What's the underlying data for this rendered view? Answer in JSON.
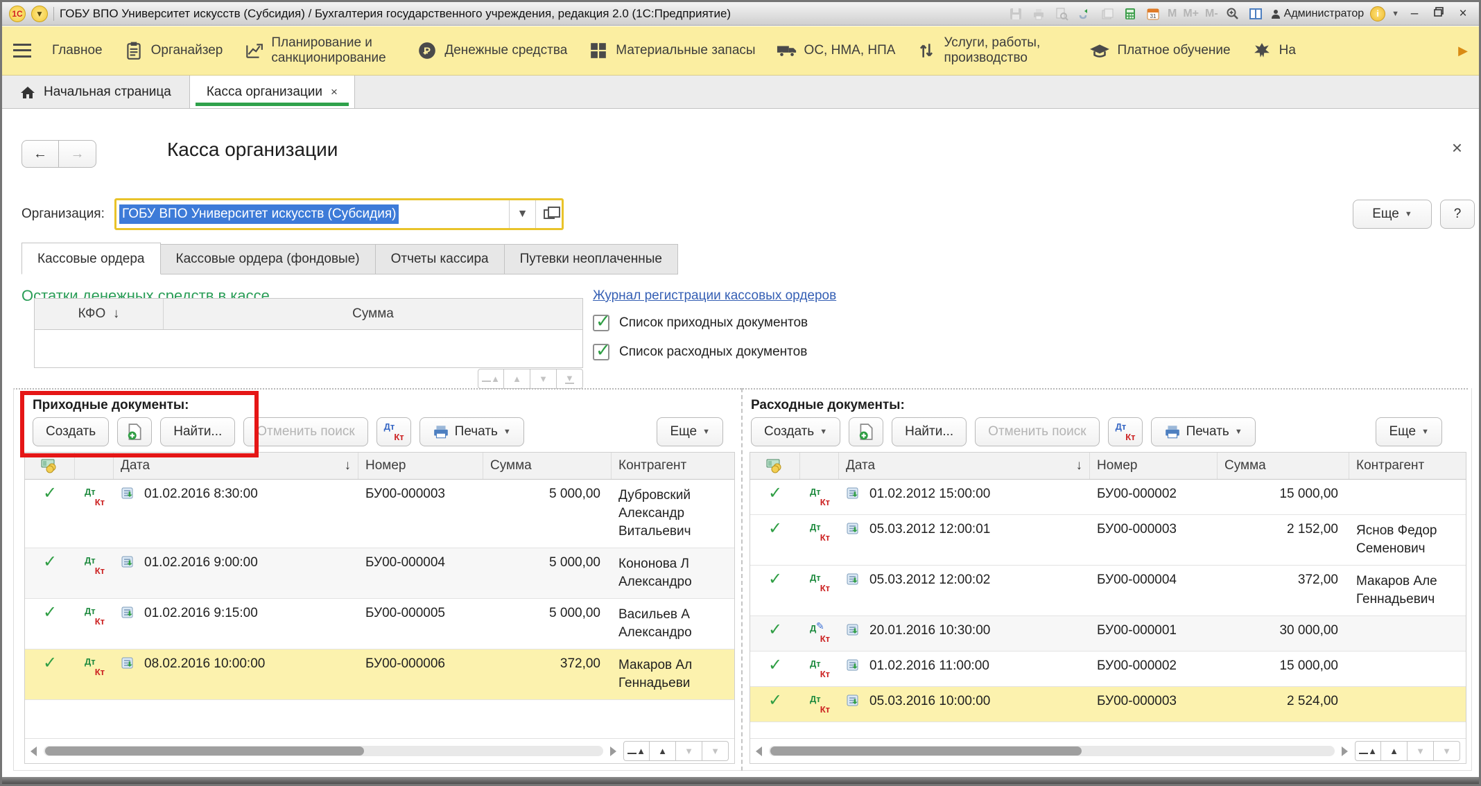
{
  "titlebar": {
    "title": "ГОБУ ВПО Университет искусств (Субсидия) / Бухгалтерия государственного учреждения, редакция 2.0  (1С:Предприятие)",
    "memory_buttons": [
      "M",
      "M+",
      "M-"
    ],
    "user": "Администратор"
  },
  "ribbon": {
    "items": [
      {
        "icon": "none",
        "label": "Главное",
        "wrap": false
      },
      {
        "icon": "clipboard",
        "label": "Органайзер",
        "wrap": false
      },
      {
        "icon": "planning",
        "label": "Планирование и санкционирование",
        "wrap": true
      },
      {
        "icon": "ruble",
        "label": "Денежные средства",
        "wrap": false
      },
      {
        "icon": "grid",
        "label": "Материальные запасы",
        "wrap": false
      },
      {
        "icon": "truck",
        "label": "ОС, НМА, НПА",
        "wrap": false
      },
      {
        "icon": "updown",
        "label": "Услуги, работы, производство",
        "wrap": true
      },
      {
        "icon": "gradcap",
        "label": "Платное обучение",
        "wrap": false
      },
      {
        "icon": "emblem",
        "label": "На",
        "wrap": false
      }
    ]
  },
  "tabbar": {
    "home": "Начальная страница",
    "active_tab": "Касса организации",
    "close_glyph": "×"
  },
  "form": {
    "title": "Касса организации",
    "org_label": "Организация:",
    "org_value": "ГОБУ ВПО Университет искусств (Субсидия)",
    "more_label": "Еще",
    "help_label": "?"
  },
  "subtabs": [
    {
      "label": "Кассовые ордера",
      "active": true
    },
    {
      "label": "Кассовые ордера (фондовые)",
      "active": false
    },
    {
      "label": "Отчеты кассира",
      "active": false
    },
    {
      "label": "Путевки неоплаченные",
      "active": false
    }
  ],
  "balances": {
    "heading": "Остатки денежных средств в кассе",
    "columns": [
      "КФО",
      "Сумма"
    ],
    "rows": []
  },
  "journal_link": "Журнал регистрации кассовых ордеров",
  "checkboxes": [
    {
      "label": "Список приходных документов",
      "checked": true
    },
    {
      "label": "Список расходных документов",
      "checked": true
    }
  ],
  "income_panel": {
    "label": "Приходные документы:",
    "buttons": {
      "create": "Создать",
      "create_has_dropdown": false,
      "find": "Найти...",
      "cancel_search": "Отменить поиск",
      "print": "Печать",
      "more": "Еще"
    },
    "columns": {
      "date": "Дата",
      "number": "Номер",
      "amount": "Сумма",
      "contragent": "Контрагент"
    },
    "rows": [
      {
        "date": "01.02.2016 8:30:00",
        "number": "БУ00-000003",
        "amount": "5 000,00",
        "contragent": [
          "Дубровский",
          "Александр",
          "Витальевич"
        ],
        "selected": false,
        "shaded": false,
        "edited": false
      },
      {
        "date": "01.02.2016 9:00:00",
        "number": "БУ00-000004",
        "amount": "5 000,00",
        "contragent": [
          "Кононова Л",
          "Александро"
        ],
        "selected": false,
        "shaded": true,
        "edited": false
      },
      {
        "date": "01.02.2016 9:15:00",
        "number": "БУ00-000005",
        "amount": "5 000,00",
        "contragent": [
          "Васильев А",
          "Александро"
        ],
        "selected": false,
        "shaded": false,
        "edited": false
      },
      {
        "date": "08.02.2016 10:00:00",
        "number": "БУ00-000006",
        "amount": "372,00",
        "contragent": [
          "Макаров Ал",
          "Геннадьеви"
        ],
        "selected": true,
        "shaded": false,
        "edited": false
      }
    ]
  },
  "expense_panel": {
    "label": "Расходные документы:",
    "buttons": {
      "create": "Создать",
      "create_has_dropdown": true,
      "find": "Найти...",
      "cancel_search": "Отменить поиск",
      "print": "Печать",
      "more": "Еще"
    },
    "columns": {
      "date": "Дата",
      "number": "Номер",
      "amount": "Сумма",
      "contragent": "Контрагент"
    },
    "rows": [
      {
        "date": "01.02.2012 15:00:00",
        "number": "БУ00-000002",
        "amount": "15 000,00",
        "contragent": [],
        "selected": false,
        "shaded": false,
        "edited": false
      },
      {
        "date": "05.03.2012 12:00:01",
        "number": "БУ00-000003",
        "amount": "2 152,00",
        "contragent": [
          "Яснов Федор",
          "Семенович"
        ],
        "selected": false,
        "shaded": false,
        "edited": false
      },
      {
        "date": "05.03.2012 12:00:02",
        "number": "БУ00-000004",
        "amount": "372,00",
        "contragent": [
          "Макаров Але",
          "Геннадьевич"
        ],
        "selected": false,
        "shaded": false,
        "edited": false
      },
      {
        "date": "20.01.2016 10:30:00",
        "number": "БУ00-000001",
        "amount": "30 000,00",
        "contragent": [],
        "selected": false,
        "shaded": true,
        "edited": true
      },
      {
        "date": "01.02.2016 11:00:00",
        "number": "БУ00-000002",
        "amount": "15 000,00",
        "contragent": [],
        "selected": false,
        "shaded": false,
        "edited": false
      },
      {
        "date": "05.03.2016 10:00:00",
        "number": "БУ00-000003",
        "amount": "2 524,00",
        "contragent": [],
        "selected": true,
        "shaded": false,
        "edited": false
      }
    ]
  },
  "colors": {
    "ribbon_bg": "#fbeea1",
    "active_tab_underline": "#2fa14b",
    "link_blue": "#355fb4",
    "heading_green": "#2a9d57",
    "selected_row": "#fcf2ae",
    "highlight_red": "#e51616",
    "combo_focus_border": "#e9c32a",
    "selection_blue": "#3d7bd8"
  }
}
